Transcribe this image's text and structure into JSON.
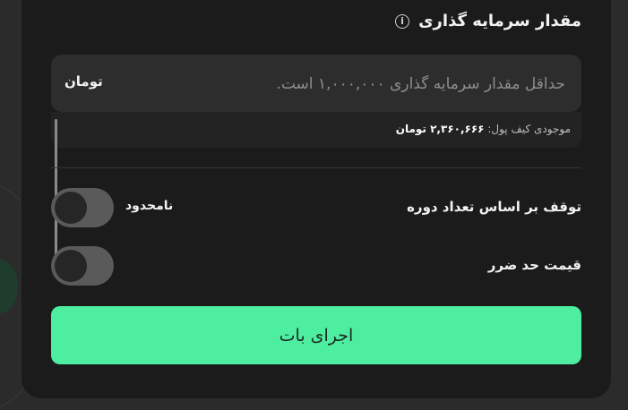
{
  "investment": {
    "title": "مقدار سرمایه گذاری",
    "info_icon": "info-icon",
    "input_placeholder": "حداقل مقدار سرمایه گذاری ۱,۰۰۰,۰۰۰ است.",
    "input_value": "",
    "unit": "تومان"
  },
  "wallet": {
    "label": "موجودی کیف پول:",
    "amount": "۲,۳۶۰,۶۶۶ تومان"
  },
  "stop_by_periods": {
    "label": "توقف بر اساس تعداد دوره",
    "toggle_on": false,
    "state_text": "نامحدود"
  },
  "stop_loss": {
    "label": "قیمت حد ضرر",
    "toggle_on": false
  },
  "run_button": {
    "label": "اجرای بات"
  },
  "colors": {
    "accent": "#4eeea0",
    "card_bg": "#1b1b1b",
    "input_bg": "#2d2d2d",
    "toggle_off": "#5a5a5a"
  }
}
